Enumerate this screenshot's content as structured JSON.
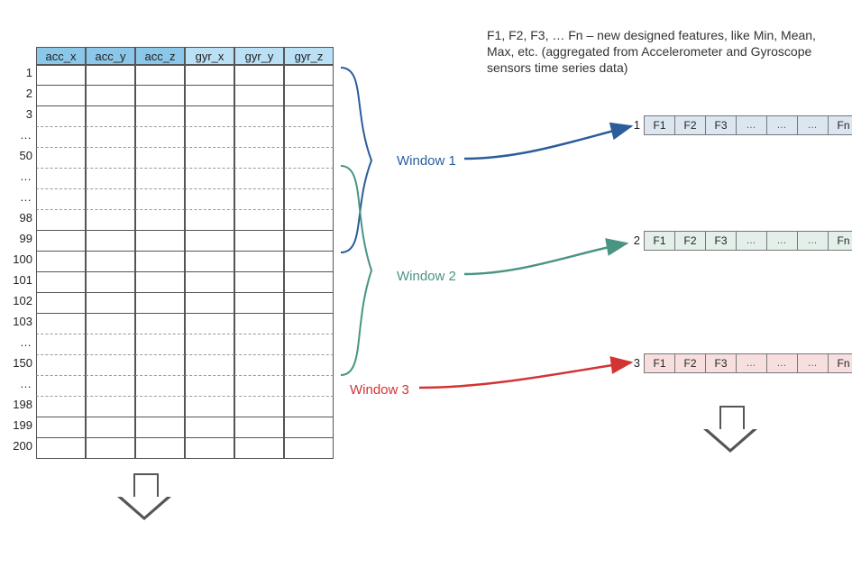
{
  "description": "F1, F2, F3, … Fn – new designed features, like Min, Mean, Max, etc. (aggregated from Accelerometer and Gyroscope sensors time series data)",
  "table": {
    "headers": [
      "acc_x",
      "acc_y",
      "acc_z",
      "gyr_x",
      "gyr_y",
      "gyr_z"
    ],
    "row_labels": [
      "1",
      "2",
      "3",
      "…",
      "50",
      "…",
      "…",
      "98",
      "99",
      "100",
      "101",
      "102",
      "103",
      "…",
      "150",
      "…",
      "198",
      "199",
      "200"
    ]
  },
  "windows": {
    "w1": {
      "label": "Window 1",
      "color": "#2b5d9b"
    },
    "w2": {
      "label": "Window 2",
      "color": "#4a9484"
    },
    "w3": {
      "label": "Window 3",
      "color": "#d23434"
    }
  },
  "features": {
    "cells": [
      "F1",
      "F2",
      "F3",
      "…",
      "…",
      "…",
      "Fn"
    ],
    "rows": [
      {
        "n": "1",
        "class": "blue"
      },
      {
        "n": "2",
        "class": "green"
      },
      {
        "n": "3",
        "class": "red"
      }
    ]
  }
}
